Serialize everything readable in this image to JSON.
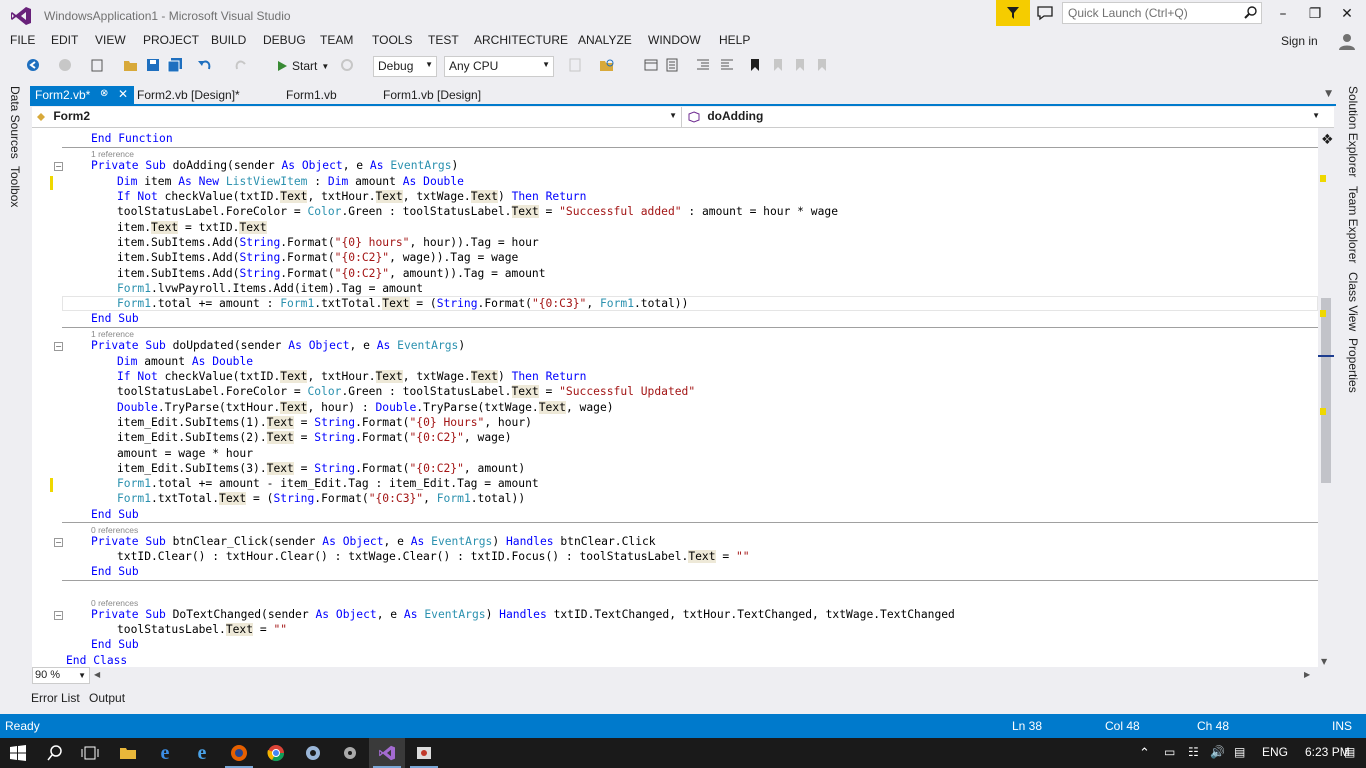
{
  "window": {
    "title": "WindowsApplication1 - Microsoft Visual Studio",
    "quick_launch_placeholder": "Quick Launch (Ctrl+Q)",
    "sign_in": "Sign in"
  },
  "menu": [
    "FILE",
    "EDIT",
    "VIEW",
    "PROJECT",
    "BUILD",
    "DEBUG",
    "TEAM",
    "TOOLS",
    "TEST",
    "ARCHITECTURE",
    "ANALYZE",
    "WINDOW",
    "HELP"
  ],
  "toolbar": {
    "start_label": "Start",
    "config": "Debug",
    "platform": "Any CPU"
  },
  "tabs": [
    {
      "label": "Form2.vb*",
      "active": true
    },
    {
      "label": "Form2.vb [Design]*",
      "active": false
    },
    {
      "label": "Form1.vb",
      "active": false
    },
    {
      "label": "Form1.vb [Design]",
      "active": false
    }
  ],
  "navbar": {
    "left": "Form2",
    "right": "doAdding"
  },
  "left_dock": [
    "Data Sources",
    "Toolbox"
  ],
  "right_dock": [
    "Solution Explorer",
    "Team Explorer",
    "Class View",
    "Properties"
  ],
  "code": {
    "refs": [
      "1 reference",
      "1 reference",
      "0 references",
      "0 references"
    ],
    "l01": "End Function",
    "l02": "Private Sub doAdding(sender As Object, e As EventArgs)",
    "l03": "Dim item As New ListViewItem : Dim amount As Double",
    "l04": "If Not checkValue(txtID.Text, txtHour.Text, txtWage.Text) Then Return",
    "l05": "toolStatusLabel.ForeColor = Color.Green : toolStatusLabel.Text = \"Successful added\" : amount = hour * wage",
    "l06": "item.Text = txtID.Text",
    "l07": "item.SubItems.Add(String.Format(\"{0} hours\", hour)).Tag = hour",
    "l08": "item.SubItems.Add(String.Format(\"{0:C2}\", wage)).Tag = wage",
    "l09": "item.SubItems.Add(String.Format(\"{0:C2}\", amount)).Tag = amount",
    "l10": "Form1.lvwPayroll.Items.Add(item).Tag = amount",
    "l11": "Form1.total += amount : Form1.txtTotal.Text = (String.Format(\"{0:C3}\", Form1.total))",
    "l12": "End Sub",
    "l13": "Private Sub doUpdated(sender As Object, e As EventArgs)",
    "l14": "Dim amount As Double",
    "l15": "If Not checkValue(txtID.Text, txtHour.Text, txtWage.Text) Then Return",
    "l16": "toolStatusLabel.ForeColor = Color.Green : toolStatusLabel.Text = \"Successful Updated\"",
    "l17": "Double.TryParse(txtHour.Text, hour) : Double.TryParse(txtWage.Text, wage)",
    "l18": "item_Edit.SubItems(1).Text = String.Format(\"{0} Hours\", hour)",
    "l19": "item_Edit.SubItems(2).Text = String.Format(\"{0:C2}\", wage)",
    "l20": "amount = wage * hour",
    "l21": "item_Edit.SubItems(3).Text = String.Format(\"{0:C2}\", amount)",
    "l22": "Form1.total += amount - item_Edit.Tag : item_Edit.Tag = amount",
    "l23": "Form1.txtTotal.Text = (String.Format(\"{0:C3}\", Form1.total))",
    "l24": "End Sub",
    "l25": "Private Sub btnClear_Click(sender As Object, e As EventArgs) Handles btnClear.Click",
    "l26": "txtID.Clear() : txtHour.Clear() : txtWage.Clear() : txtID.Focus() : toolStatusLabel.Text = \"\"",
    "l27": "End Sub",
    "l28": "Private Sub DoTextChanged(sender As Object, e As EventArgs) Handles txtID.TextChanged, txtHour.TextChanged, txtWage.TextChanged",
    "l29": "toolStatusLabel.Text = \"\"",
    "l30": "End Sub",
    "l31": "End Class"
  },
  "zoom": "90 %",
  "bottom_tabs": [
    "Error List",
    "Output"
  ],
  "status": {
    "ready": "Ready",
    "ln": "Ln 38",
    "col": "Col 48",
    "ch": "Ch 48",
    "ins": "INS"
  },
  "taskbar": {
    "lang": "ENG",
    "time": "6:23 PM"
  },
  "colors": {
    "accent": "#007acc",
    "notif": "#f5cc00",
    "keyword": "#0000ff",
    "type": "#2b91af",
    "string": "#a31515"
  }
}
